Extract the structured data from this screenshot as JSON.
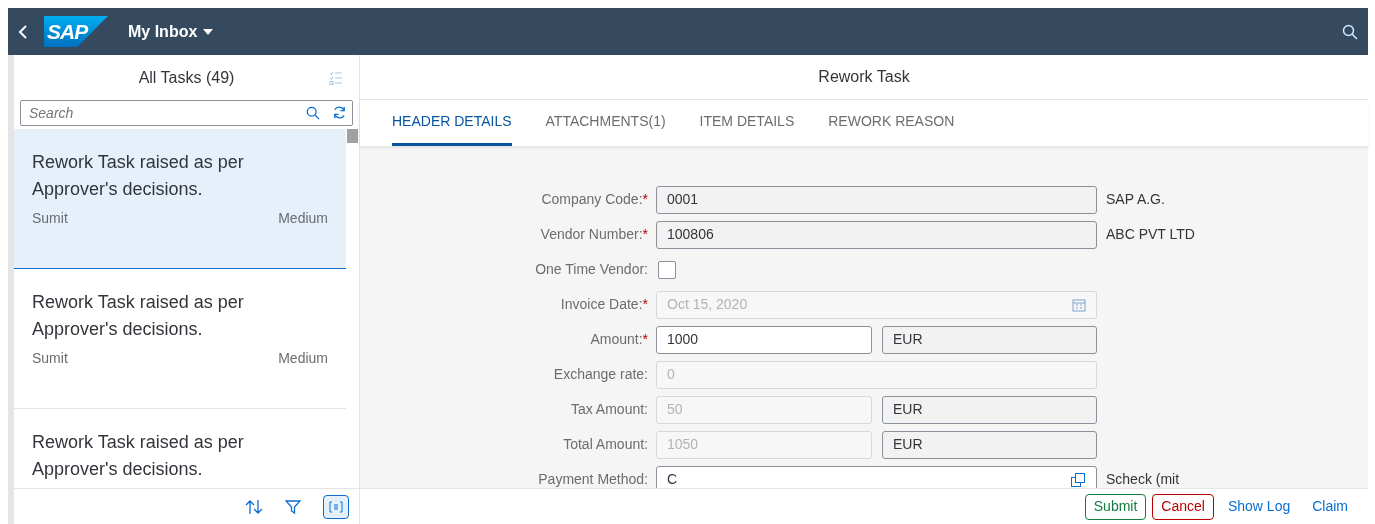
{
  "shell": {
    "logo": "SAP",
    "title": "My Inbox"
  },
  "master": {
    "title": "All Tasks (49)",
    "search": {
      "placeholder": "Search"
    },
    "items": [
      {
        "title": "Rework Task raised as per Approver's decisions.",
        "creator": "Sumit",
        "priority": "Medium",
        "selected": true
      },
      {
        "title": "Rework Task raised as per Approver's decisions.",
        "creator": "Sumit",
        "priority": "Medium",
        "selected": false
      },
      {
        "title": "Rework Task raised as per Approver's decisions.",
        "selected": false
      }
    ]
  },
  "detail": {
    "title": "Rework Task",
    "tabs": [
      {
        "label": "HEADER DETAILS",
        "selected": true
      },
      {
        "label": "ATTACHMENTS(1)",
        "selected": false
      },
      {
        "label": "ITEM DETAILS",
        "selected": false
      },
      {
        "label": "REWORK REASON",
        "selected": false
      }
    ],
    "form": [
      {
        "kind": "text",
        "label": "Company Code:",
        "required_mark": "*",
        "value": "0001",
        "editable": false,
        "disabled": false,
        "description": "SAP A.G."
      },
      {
        "kind": "text",
        "label": "Vendor Number:",
        "required_mark": "*",
        "value": "100806",
        "editable": false,
        "disabled": false,
        "description": "ABC PVT LTD"
      },
      {
        "kind": "checkbox",
        "label": "One Time Vendor:",
        "checked": false
      },
      {
        "kind": "date",
        "label": "Invoice Date:",
        "required_mark": "*",
        "value": "Oct 15, 2020",
        "disabled": true
      },
      {
        "kind": "amount",
        "label": "Amount:",
        "required_mark": "*",
        "value": "1000",
        "editable": true,
        "disabled": false,
        "currency": "EUR"
      },
      {
        "kind": "text",
        "label": "Exchange rate:",
        "value": "0",
        "disabled": true
      },
      {
        "kind": "amount",
        "label": "Tax Amount:",
        "value": "50",
        "disabled": true,
        "currency": "EUR"
      },
      {
        "kind": "amount",
        "label": "Total Amount:",
        "value": "1050",
        "disabled": true,
        "currency": "EUR"
      },
      {
        "kind": "valuehelp",
        "label": "Payment Method:",
        "value": "C",
        "editable": true,
        "disabled": false,
        "description": "Scheck (mit"
      }
    ]
  },
  "footer": {
    "actions": [
      {
        "label": "Submit",
        "kind": "accept"
      },
      {
        "label": "Cancel",
        "kind": "reject"
      },
      {
        "label": "Show Log",
        "kind": "link"
      },
      {
        "label": "Claim",
        "kind": "link"
      }
    ]
  }
}
